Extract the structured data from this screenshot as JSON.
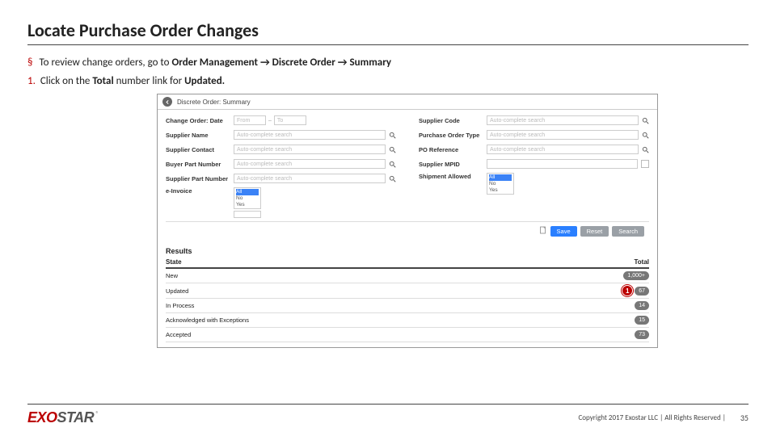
{
  "title": "Locate Purchase Order Changes",
  "bullet": {
    "pre": "To review change orders, go to ",
    "b1": "Order Management",
    "arrow": " → ",
    "b2": "Discrete Order",
    "b3": "Summary"
  },
  "step": {
    "num": "1.",
    "pre": "Click on the ",
    "b1": "Total",
    "mid": " number link for ",
    "b2": "Updated."
  },
  "shot": {
    "header": "Discrete Order: Summary",
    "placeholders": {
      "auto": "Auto-complete search",
      "from": "From",
      "to": "To"
    },
    "left_labels": {
      "change_date": "Change Order: Date",
      "supplier_name": "Supplier Name",
      "supplier_contact": "Supplier Contact",
      "buyer_part": "Buyer Part Number",
      "supplier_part": "Supplier Part Number",
      "einvoice": "e-Invoice"
    },
    "right_labels": {
      "supplier_code": "Supplier Code",
      "po_type": "Purchase Order Type",
      "po_ref": "PO Reference",
      "supplier_mpid": "Supplier MPID",
      "ship_allowed": "Shipment Allowed"
    },
    "listbox": {
      "all": "All",
      "no": "No",
      "yes": "Yes"
    },
    "buttons": {
      "save": "Save",
      "reset": "Reset",
      "search": "Search"
    },
    "results": {
      "title": "Results",
      "col_state": "State",
      "col_total": "Total",
      "rows": [
        {
          "state": "New",
          "total": "1,000+"
        },
        {
          "state": "Updated",
          "total": "67",
          "marker": "1"
        },
        {
          "state": "In Process",
          "total": "14"
        },
        {
          "state": "Acknowledged with Exceptions",
          "total": "15"
        },
        {
          "state": "Accepted",
          "total": "73"
        }
      ]
    }
  },
  "footer": {
    "logo1": "EXO",
    "logo2": "STAR",
    "reg": "®",
    "copyright": "Copyright 2017 Exostar LLC | All Rights Reserved |",
    "page": "35"
  }
}
